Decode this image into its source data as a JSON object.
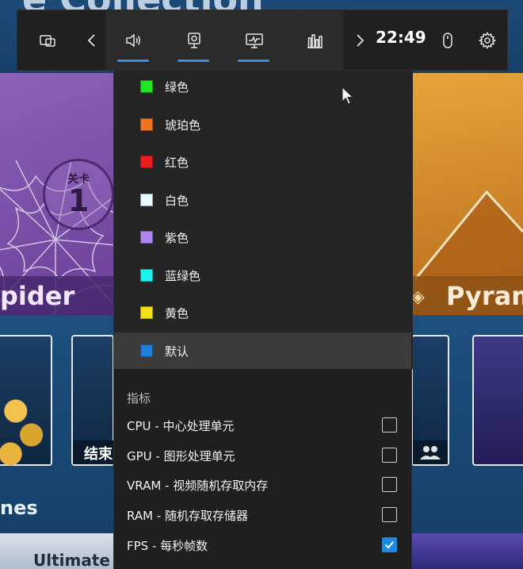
{
  "background": {
    "title_fragment": "e Collection",
    "left_card": {
      "level_label": "关卡",
      "level_number": "1",
      "name_fragment": "pider"
    },
    "right_card": {
      "name_fragment": "Pyram"
    },
    "tile_caption": "结束",
    "section_fragment": "nes",
    "bottom_card_text": "Ultimate"
  },
  "gamebar": {
    "time": "22:49",
    "icons": {
      "widget": "widget-menu-icon",
      "prev": "chevron-left-icon",
      "audio": "speaker-icon",
      "capture": "webcam-icon",
      "performance": "monitor-performance-icon",
      "resources": "bar-chart-icon",
      "next": "chevron-right-icon",
      "mouse": "mouse-icon",
      "settings": "gear-icon"
    }
  },
  "color_options": [
    {
      "label": "绿色",
      "color": "#22e422"
    },
    {
      "label": "琥珀色",
      "color": "#f07320"
    },
    {
      "label": "红色",
      "color": "#ee1c1c"
    },
    {
      "label": "白色",
      "color": "#e9fbff"
    },
    {
      "label": "紫色",
      "color": "#b085f0"
    },
    {
      "label": "蓝绿色",
      "color": "#1cf2f0"
    },
    {
      "label": "黄色",
      "color": "#f6e01c"
    },
    {
      "label": "默认",
      "color": "#1e7fdc",
      "selected": true
    }
  ],
  "metrics_section": {
    "title": "指标",
    "items": [
      {
        "label": "CPU - 中心处理单元",
        "checked": false
      },
      {
        "label": "GPU - 图形处理单元",
        "checked": false
      },
      {
        "label": "VRAM - 视频随机存取内存",
        "checked": false
      },
      {
        "label": "RAM - 随机存取存储器",
        "checked": false
      },
      {
        "label": "FPS - 每秒帧数",
        "checked": true
      }
    ]
  },
  "colors": {
    "accent": "#1e88e5",
    "panel_bg": "#1f1f1f",
    "toolbar_bg": "#202020"
  }
}
